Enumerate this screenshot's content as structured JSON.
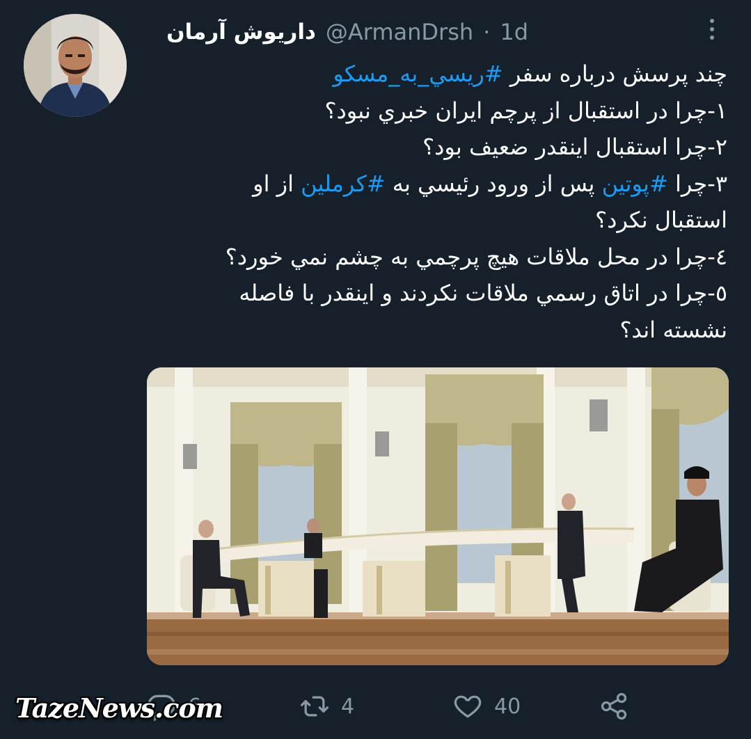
{
  "tweet": {
    "author_name": "داریوش آرمان",
    "handle": "@ArmanDrsh",
    "separator": "·",
    "time": "1d",
    "text": {
      "line1_prefix": "چند پرسش درباره سفر ",
      "line1_tag": "#ريسي_به_مسكو",
      "line2": "١-چرا در استقبال از پرچم ايران خبري نبود؟",
      "line3": "٢-چرا استقبال اينقدر ضعيف بود؟",
      "line4_prefix": "٣-چرا ",
      "line4_tag1": "#پوتين",
      "line4_middle": " پس از ورود رئيسي به ",
      "line4_tag2": "#كرملين",
      "line4_suffix": " از او",
      "line5": "استقبال نكرد؟",
      "line6": "٤-چرا در محل ملاقات هيچ پرچمي به چشم نمي خورد؟",
      "line7": "٥-چرا در اتاق رسمي ملاقات نكردند و اينقدر با فاصله",
      "line8": "نشسته اند؟"
    },
    "media_icon": "photo-meeting-room",
    "stats": {
      "replies": "6",
      "retweets": "4",
      "likes": "40"
    }
  },
  "icons": {
    "reply": "reply-icon",
    "retweet": "retweet-icon",
    "like": "heart-icon",
    "share": "share-icon",
    "more": "more-options-icon"
  },
  "watermark": "TazeNews.com",
  "colors": {
    "background": "#15202b",
    "text": "#ffffff",
    "secondary": "#8899a6",
    "hashtag": "#1d9bf0"
  }
}
